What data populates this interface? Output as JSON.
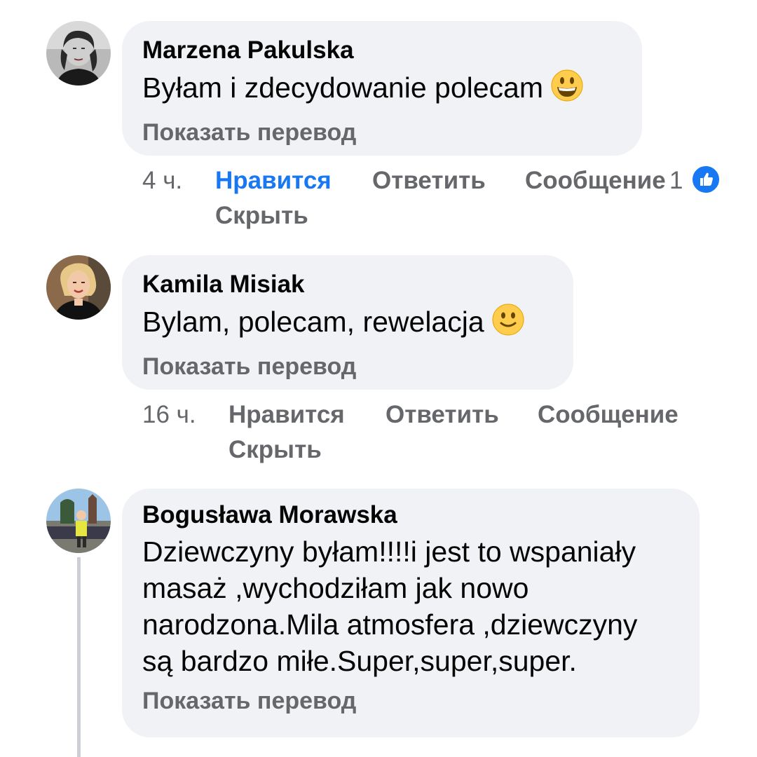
{
  "comments": [
    {
      "author": "Marzena Pakulska",
      "text": "Byłam i zdecydowanie polecam",
      "emoji": "grinning-face",
      "translate_label": "Показать перевод",
      "time": "4 ч.",
      "like_label": "Нравится",
      "reply_label": "Ответить",
      "message_label": "Сообщение",
      "hide_label": "Скрыть",
      "reaction_count": "1",
      "liked": true
    },
    {
      "author": "Kamila Misiak",
      "text": "Bylam, polecam, rewelacja",
      "emoji": "slightly-smiling-face",
      "translate_label": "Показать перевод",
      "time": "16 ч.",
      "like_label": "Нравится",
      "reply_label": "Ответить",
      "message_label": "Сообщение",
      "hide_label": "Скрыть",
      "liked": false
    },
    {
      "author": "Bogusława Morawska",
      "text_lines": [
        "Dziewczyny byłam!!!!i jest to wspaniały",
        "masaż ,wychodziłam jak nowo",
        "narodzona.Mila atmosfera ,dziewczyny",
        "są bardzo miłe.Super,super,super."
      ],
      "translate_label": "Показать перевод"
    }
  ],
  "colors": {
    "bubble": "#f0f2f5",
    "muted_text": "#65676b",
    "accent_blue": "#1877f2",
    "emoji_yellow": "#ffcc4d"
  }
}
